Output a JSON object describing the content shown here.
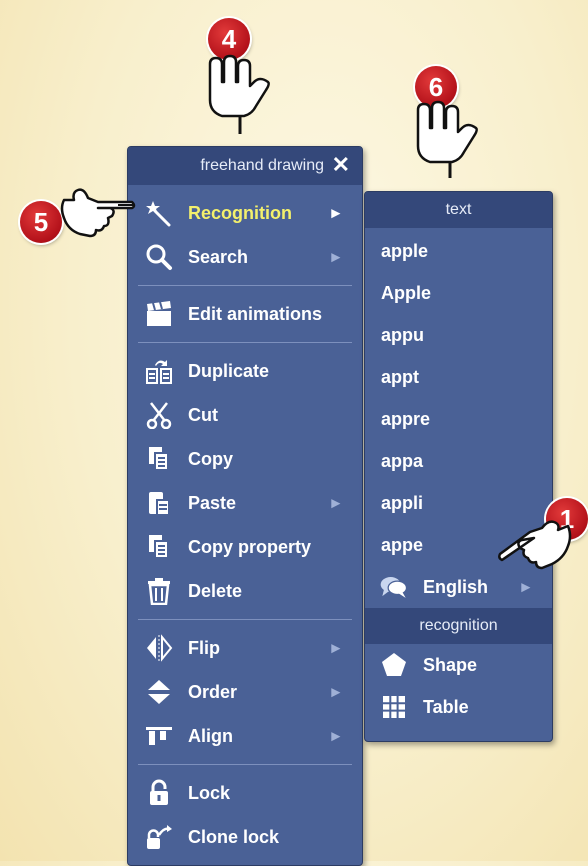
{
  "left_menu": {
    "header": "freehand drawing",
    "close_glyph": "✕",
    "items": [
      {
        "label": "Recognition",
        "icon": "magic-wand-icon",
        "submenu": true,
        "highlighted": true
      },
      {
        "label": "Search",
        "icon": "search-icon",
        "submenu": true
      },
      {
        "label": "Edit animations",
        "icon": "clapperboard-icon"
      },
      {
        "label": "Duplicate",
        "icon": "duplicate-icon"
      },
      {
        "label": "Cut",
        "icon": "scissors-icon"
      },
      {
        "label": "Copy",
        "icon": "copy-icon"
      },
      {
        "label": "Paste",
        "icon": "paste-icon",
        "submenu": true
      },
      {
        "label": "Copy property",
        "icon": "copy-property-icon"
      },
      {
        "label": "Delete",
        "icon": "trash-icon"
      },
      {
        "label": "Flip",
        "icon": "flip-icon",
        "submenu": true
      },
      {
        "label": "Order",
        "icon": "order-icon",
        "submenu": true
      },
      {
        "label": "Align",
        "icon": "align-icon",
        "submenu": true
      },
      {
        "label": "Lock",
        "icon": "lock-icon"
      },
      {
        "label": "Clone lock",
        "icon": "clone-lock-icon"
      }
    ]
  },
  "right_menu": {
    "text_header": "text",
    "candidates": [
      "apple",
      "Apple",
      "appu",
      "appt",
      "appre",
      "appa",
      "appli",
      "appe"
    ],
    "language": {
      "label": "English",
      "icon": "speech-bubbles-icon",
      "submenu": true
    },
    "recognition_header": "recognition",
    "recognition_items": [
      {
        "label": "Shape",
        "icon": "pentagon-icon"
      },
      {
        "label": "Table",
        "icon": "table-grid-icon"
      }
    ]
  },
  "callouts": [
    {
      "number": "4"
    },
    {
      "number": "5"
    },
    {
      "number": "6"
    },
    {
      "number": "1"
    }
  ],
  "colors": {
    "menu_bg": "#4a6196",
    "header_bg": "#34487a",
    "highlight_text": "#f3f06c",
    "badge_red": "#c0141c"
  },
  "arrow_glyph": "▶"
}
